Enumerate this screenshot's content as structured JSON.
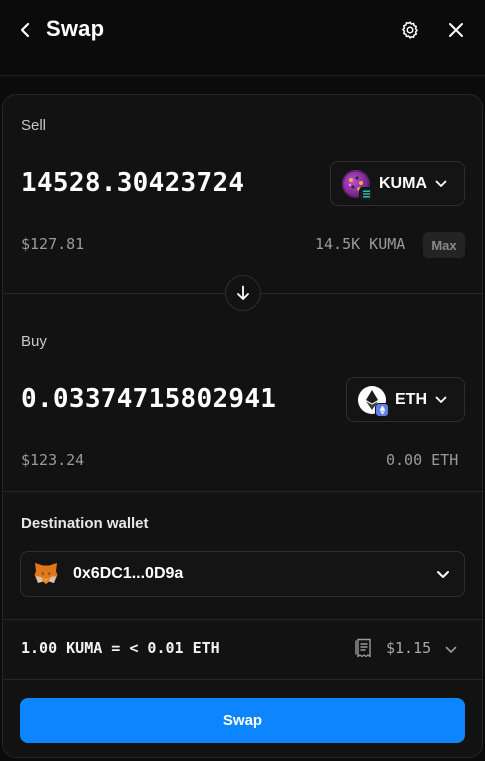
{
  "header": {
    "title": "Swap",
    "back_icon": "chevron-left-icon",
    "settings_icon": "gear-icon",
    "close_icon": "close-icon"
  },
  "sell": {
    "label": "Sell",
    "amount": "14528.30423724",
    "usd_value": "$127.81",
    "token": {
      "symbol": "KUMA",
      "logo_icon": "kuma-token-icon",
      "chain_badge_icon": "solana-chain-icon"
    },
    "balance": "14.5K KUMA",
    "max_label": "Max"
  },
  "swap_direction_icon": "arrow-down-icon",
  "buy": {
    "label": "Buy",
    "amount": "0.03374715802941",
    "usd_value": "$123.24",
    "token": {
      "symbol": "ETH",
      "logo_icon": "ethereum-token-icon",
      "chain_badge_icon": "ethereum-chain-icon"
    },
    "balance": "0.00 ETH"
  },
  "destination": {
    "label": "Destination wallet",
    "wallet_icon": "metamask-fox-icon",
    "address": "0x6DC1...0D9a"
  },
  "quote": {
    "rate": "1.00 KUMA = < 0.01 ETH",
    "fee_icon": "receipt-icon",
    "fee": "$1.15"
  },
  "swap_button_label": "Swap",
  "colors": {
    "background": "#0b0b0b",
    "panel": "#121212",
    "accent": "#0c85ff",
    "muted_text": "#9a9a9a"
  }
}
